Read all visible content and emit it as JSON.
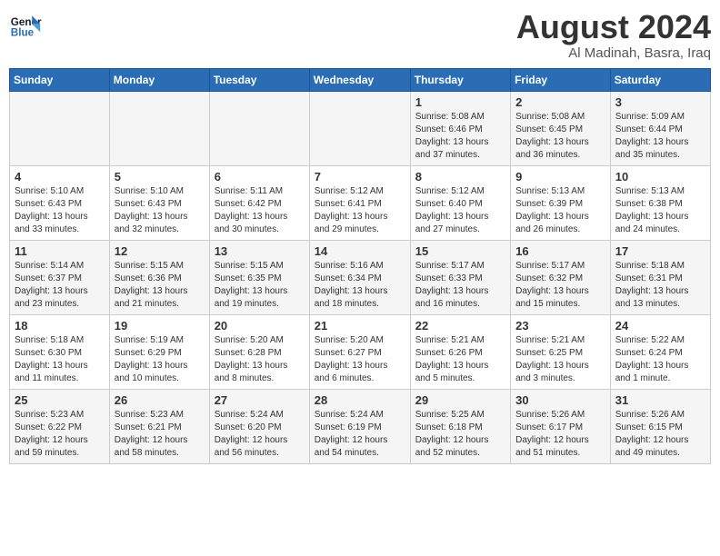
{
  "header": {
    "logo_general": "General",
    "logo_blue": "Blue",
    "month_year": "August 2024",
    "location": "Al Madinah, Basra, Iraq"
  },
  "days_of_week": [
    "Sunday",
    "Monday",
    "Tuesday",
    "Wednesday",
    "Thursday",
    "Friday",
    "Saturday"
  ],
  "weeks": [
    [
      {
        "day": "",
        "info": ""
      },
      {
        "day": "",
        "info": ""
      },
      {
        "day": "",
        "info": ""
      },
      {
        "day": "",
        "info": ""
      },
      {
        "day": "1",
        "info": "Sunrise: 5:08 AM\nSunset: 6:46 PM\nDaylight: 13 hours\nand 37 minutes."
      },
      {
        "day": "2",
        "info": "Sunrise: 5:08 AM\nSunset: 6:45 PM\nDaylight: 13 hours\nand 36 minutes."
      },
      {
        "day": "3",
        "info": "Sunrise: 5:09 AM\nSunset: 6:44 PM\nDaylight: 13 hours\nand 35 minutes."
      }
    ],
    [
      {
        "day": "4",
        "info": "Sunrise: 5:10 AM\nSunset: 6:43 PM\nDaylight: 13 hours\nand 33 minutes."
      },
      {
        "day": "5",
        "info": "Sunrise: 5:10 AM\nSunset: 6:43 PM\nDaylight: 13 hours\nand 32 minutes."
      },
      {
        "day": "6",
        "info": "Sunrise: 5:11 AM\nSunset: 6:42 PM\nDaylight: 13 hours\nand 30 minutes."
      },
      {
        "day": "7",
        "info": "Sunrise: 5:12 AM\nSunset: 6:41 PM\nDaylight: 13 hours\nand 29 minutes."
      },
      {
        "day": "8",
        "info": "Sunrise: 5:12 AM\nSunset: 6:40 PM\nDaylight: 13 hours\nand 27 minutes."
      },
      {
        "day": "9",
        "info": "Sunrise: 5:13 AM\nSunset: 6:39 PM\nDaylight: 13 hours\nand 26 minutes."
      },
      {
        "day": "10",
        "info": "Sunrise: 5:13 AM\nSunset: 6:38 PM\nDaylight: 13 hours\nand 24 minutes."
      }
    ],
    [
      {
        "day": "11",
        "info": "Sunrise: 5:14 AM\nSunset: 6:37 PM\nDaylight: 13 hours\nand 23 minutes."
      },
      {
        "day": "12",
        "info": "Sunrise: 5:15 AM\nSunset: 6:36 PM\nDaylight: 13 hours\nand 21 minutes."
      },
      {
        "day": "13",
        "info": "Sunrise: 5:15 AM\nSunset: 6:35 PM\nDaylight: 13 hours\nand 19 minutes."
      },
      {
        "day": "14",
        "info": "Sunrise: 5:16 AM\nSunset: 6:34 PM\nDaylight: 13 hours\nand 18 minutes."
      },
      {
        "day": "15",
        "info": "Sunrise: 5:17 AM\nSunset: 6:33 PM\nDaylight: 13 hours\nand 16 minutes."
      },
      {
        "day": "16",
        "info": "Sunrise: 5:17 AM\nSunset: 6:32 PM\nDaylight: 13 hours\nand 15 minutes."
      },
      {
        "day": "17",
        "info": "Sunrise: 5:18 AM\nSunset: 6:31 PM\nDaylight: 13 hours\nand 13 minutes."
      }
    ],
    [
      {
        "day": "18",
        "info": "Sunrise: 5:18 AM\nSunset: 6:30 PM\nDaylight: 13 hours\nand 11 minutes."
      },
      {
        "day": "19",
        "info": "Sunrise: 5:19 AM\nSunset: 6:29 PM\nDaylight: 13 hours\nand 10 minutes."
      },
      {
        "day": "20",
        "info": "Sunrise: 5:20 AM\nSunset: 6:28 PM\nDaylight: 13 hours\nand 8 minutes."
      },
      {
        "day": "21",
        "info": "Sunrise: 5:20 AM\nSunset: 6:27 PM\nDaylight: 13 hours\nand 6 minutes."
      },
      {
        "day": "22",
        "info": "Sunrise: 5:21 AM\nSunset: 6:26 PM\nDaylight: 13 hours\nand 5 minutes."
      },
      {
        "day": "23",
        "info": "Sunrise: 5:21 AM\nSunset: 6:25 PM\nDaylight: 13 hours\nand 3 minutes."
      },
      {
        "day": "24",
        "info": "Sunrise: 5:22 AM\nSunset: 6:24 PM\nDaylight: 13 hours\nand 1 minute."
      }
    ],
    [
      {
        "day": "25",
        "info": "Sunrise: 5:23 AM\nSunset: 6:22 PM\nDaylight: 12 hours\nand 59 minutes."
      },
      {
        "day": "26",
        "info": "Sunrise: 5:23 AM\nSunset: 6:21 PM\nDaylight: 12 hours\nand 58 minutes."
      },
      {
        "day": "27",
        "info": "Sunrise: 5:24 AM\nSunset: 6:20 PM\nDaylight: 12 hours\nand 56 minutes."
      },
      {
        "day": "28",
        "info": "Sunrise: 5:24 AM\nSunset: 6:19 PM\nDaylight: 12 hours\nand 54 minutes."
      },
      {
        "day": "29",
        "info": "Sunrise: 5:25 AM\nSunset: 6:18 PM\nDaylight: 12 hours\nand 52 minutes."
      },
      {
        "day": "30",
        "info": "Sunrise: 5:26 AM\nSunset: 6:17 PM\nDaylight: 12 hours\nand 51 minutes."
      },
      {
        "day": "31",
        "info": "Sunrise: 5:26 AM\nSunset: 6:15 PM\nDaylight: 12 hours\nand 49 minutes."
      }
    ]
  ]
}
